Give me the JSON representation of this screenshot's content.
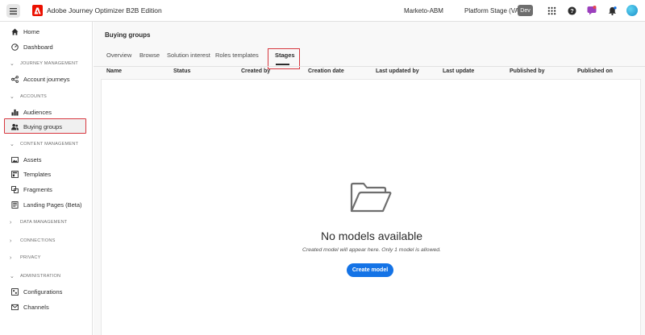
{
  "header": {
    "app_title": "Adobe Journey Optimizer B2B Edition",
    "org_name": "Marketo-ABM",
    "sandbox": "Platform Stage (VA7)",
    "env_badge": "Dev"
  },
  "sidebar": {
    "home": "Home",
    "dashboard": "Dashboard",
    "section_journey": "JOURNEY MANAGEMENT",
    "account_journeys": "Account journeys",
    "section_accounts": "ACCOUNTS",
    "audiences": "Audiences",
    "buying_groups": "Buying groups",
    "section_content": "CONTENT MANAGEMENT",
    "assets": "Assets",
    "templates": "Templates",
    "fragments": "Fragments",
    "landing_pages": "Landing Pages (Beta)",
    "section_data": "DATA MANAGEMENT",
    "section_connections": "CONNECTIONS",
    "section_privacy": "PRIVACY",
    "section_admin": "ADMINISTRATION",
    "configurations": "Configurations",
    "channels": "Channels"
  },
  "main": {
    "page_title": "Buying groups",
    "tabs": [
      "Overview",
      "Browse",
      "Solution interest",
      "Roles templates",
      "Stages"
    ],
    "active_tab": "Stages",
    "columns": [
      "Name",
      "Status",
      "Created by",
      "Creation date",
      "Last updated by",
      "Last update",
      "Published by",
      "Published on"
    ],
    "empty_title": "No models available",
    "empty_desc": "Created model will appear here. Only 1 model is allowed.",
    "create_button": "Create model"
  },
  "colors": {
    "accent": "#1473e6",
    "highlight": "#d7373f",
    "adobe_red": "#eb1000"
  }
}
